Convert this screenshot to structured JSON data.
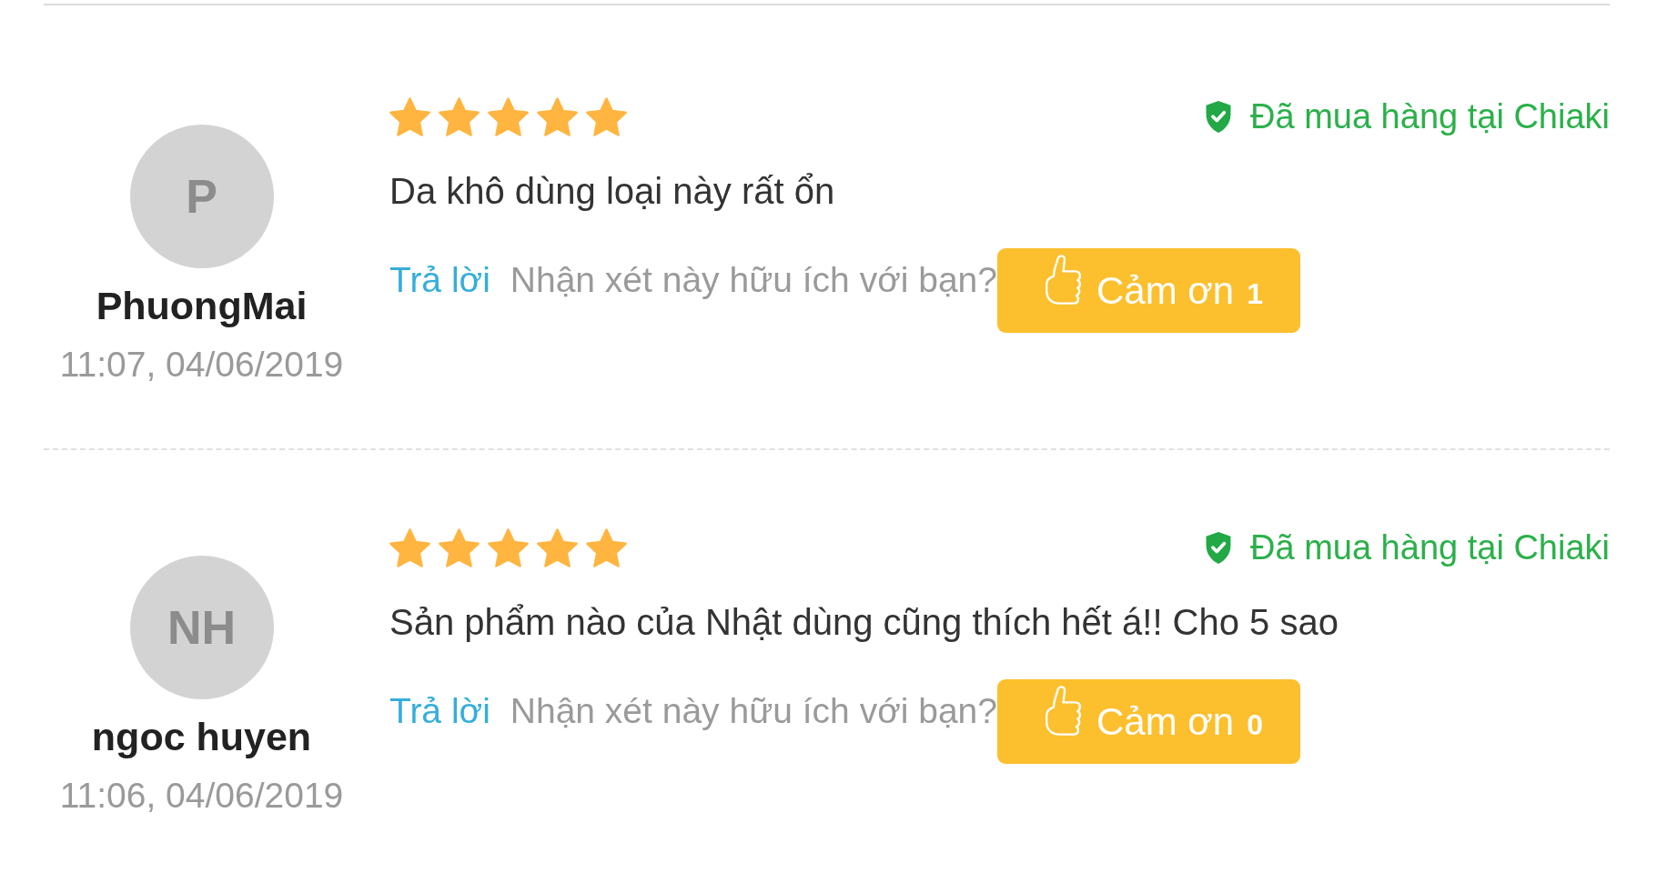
{
  "reviews": [
    {
      "avatar": "P",
      "author": "PhuongMai",
      "date": "11:07, 04/06/2019",
      "stars": 5,
      "verified_label": "Đã mua hàng tại Chiaki",
      "text": "Da khô dùng loại này rất ổn",
      "reply_link": "Trả lời",
      "helpful_prompt": "Nhận xét này hữu ích với bạn?",
      "thanks_button": {
        "label": "Cảm ơn",
        "count": "1"
      }
    },
    {
      "avatar": "NH",
      "author": "ngoc huyen",
      "date": "11:06, 04/06/2019",
      "stars": 5,
      "verified_label": "Đã mua hàng tại Chiaki",
      "text": "Sản phẩm nào của Nhật dùng cũng thích hết á!! Cho 5 sao",
      "reply_link": "Trả lời",
      "helpful_prompt": "Nhận xét này hữu ích với bạn?",
      "thanks_button": {
        "label": "Cảm ơn",
        "count": "0"
      }
    }
  ]
}
